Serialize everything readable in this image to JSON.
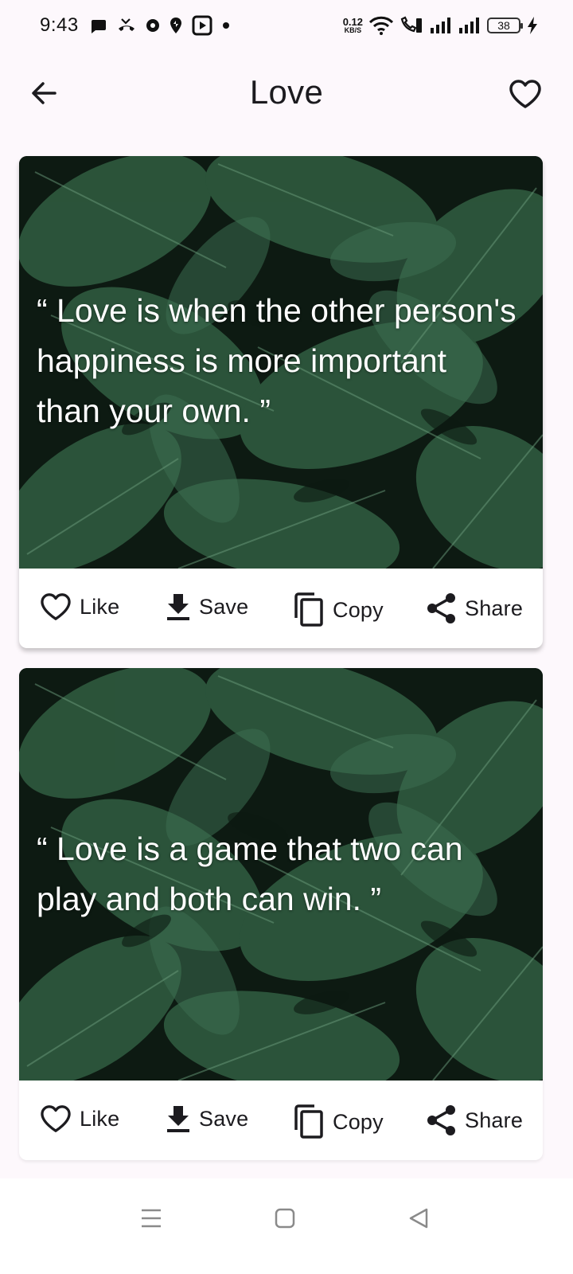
{
  "status_bar": {
    "time": "9:43",
    "net_speed_value": "0.12",
    "net_speed_unit": "KB/S",
    "battery": "38",
    "icons": [
      "message-icon",
      "missed-call-icon",
      "app-icon",
      "app-icon-2",
      "youtube-icon",
      "dot-icon",
      "wifi-icon",
      "volte-call-icon",
      "signal-icon",
      "signal-icon-2",
      "battery-icon",
      "charging-icon"
    ]
  },
  "app_bar": {
    "title": "Love",
    "back_icon": "arrow-left-icon",
    "favorite_icon": "heart-outline-icon"
  },
  "quotes": [
    {
      "text": "“ Love is when the other person's happiness is more important than your own. ”",
      "actions": {
        "like": "Like",
        "save": "Save",
        "copy": "Copy",
        "share": "Share"
      }
    },
    {
      "text": "“ Love is a game that two can play and both can win. ”",
      "actions": {
        "like": "Like",
        "save": "Save",
        "copy": "Copy",
        "share": "Share"
      }
    }
  ],
  "nav_bar": {
    "icons": [
      "menu-icon",
      "home-icon",
      "back-triangle-icon"
    ]
  },
  "colors": {
    "background": "#fdf8fc",
    "card": "#ffffff",
    "text": "#1c1b1f",
    "leaf_dark": "#0d1a12",
    "leaf_green": "#2f5a3f"
  }
}
